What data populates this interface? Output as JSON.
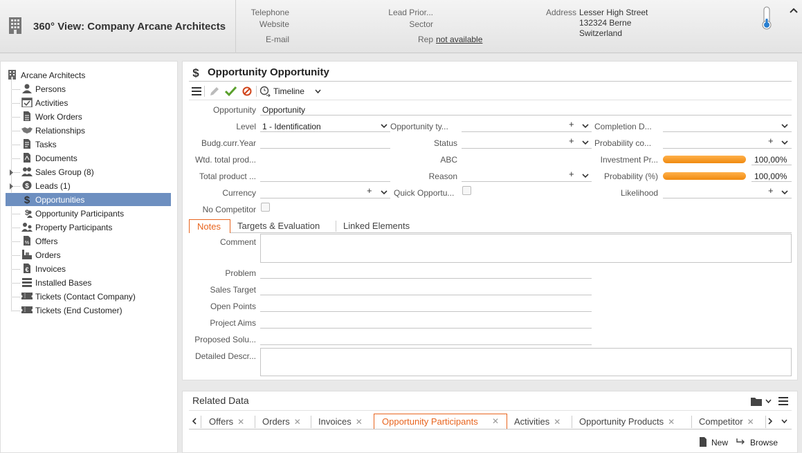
{
  "header": {
    "title": "360° View: Company Arcane Architects",
    "fields": [
      {
        "label": "Telephone",
        "value": ""
      },
      {
        "label": "Website",
        "value": ""
      },
      {
        "label": "E-mail",
        "value": ""
      },
      {
        "label": "Lead Prior...",
        "value": ""
      },
      {
        "label": "Sector",
        "value": ""
      },
      {
        "label": "Rep",
        "value": "not available"
      },
      {
        "label": "Address",
        "value": "Lesser High Street"
      }
    ],
    "address_line2": "132324 Berne",
    "address_line3": "Switzerland"
  },
  "tree": {
    "root": "Arcane Architects",
    "items": [
      {
        "label": "Persons",
        "icon": "person-icon"
      },
      {
        "label": "Activities",
        "icon": "calendar-check-icon"
      },
      {
        "label": "Work Orders",
        "icon": "document-icon"
      },
      {
        "label": "Relationships",
        "icon": "handshake-icon"
      },
      {
        "label": "Tasks",
        "icon": "task-icon"
      },
      {
        "label": "Documents",
        "icon": "document-icon"
      },
      {
        "label": "Sales Group (8)",
        "icon": "group-icon"
      },
      {
        "label": "Leads (1)",
        "icon": "lead-icon"
      },
      {
        "label": "Opportunities",
        "icon": "dollar-icon"
      },
      {
        "label": "Opportunity Participants",
        "icon": "participants-icon"
      },
      {
        "label": "Property Participants",
        "icon": "participants-icon"
      },
      {
        "label": "Offers",
        "icon": "offer-icon"
      },
      {
        "label": "Orders",
        "icon": "order-icon"
      },
      {
        "label": "Invoices",
        "icon": "euro-icon"
      },
      {
        "label": "Installed Bases",
        "icon": "installed-base-icon"
      },
      {
        "label": "Tickets (Contact Company)",
        "icon": "ticket-icon"
      },
      {
        "label": "Tickets (End Customer)",
        "icon": "ticket-icon"
      }
    ]
  },
  "card": {
    "title": "Opportunity Opportunity",
    "toolbar": {
      "timeline": "Timeline"
    },
    "fields": {
      "opportunity": {
        "label": "Opportunity",
        "value": "Opportunity"
      },
      "level": {
        "label": "Level",
        "value": "1 - Identification"
      },
      "opportunity_type": {
        "label": "Opportunity ty..."
      },
      "completion_date": {
        "label": "Completion D..."
      },
      "budg_year": {
        "label": "Budg.curr.Year"
      },
      "status": {
        "label": "Status"
      },
      "probability_co": {
        "label": "Probability co..."
      },
      "wtd_total": {
        "label": "Wtd. total prod..."
      },
      "abc": {
        "label": "ABC"
      },
      "investment_pr": {
        "label": "Investment Pr...",
        "value": "100,00%"
      },
      "total_product": {
        "label": "Total product ..."
      },
      "reason": {
        "label": "Reason"
      },
      "probability_pct": {
        "label": "Probability (%)",
        "value": "100,00%"
      },
      "currency": {
        "label": "Currency"
      },
      "quick_opportunity": {
        "label": "Quick Opportu..."
      },
      "likelihood": {
        "label": "Likelihood"
      },
      "no_competitor": {
        "label": "No Competitor"
      }
    },
    "investment_level": 1.0,
    "probability_level": 1.0,
    "tabs": [
      "Notes",
      "Targets & Evaluation",
      "Linked Elements"
    ],
    "notes": {
      "comment": "Comment",
      "problem": "Problem",
      "sales_target": "Sales Target",
      "open_points": "Open Points",
      "project_aims": "Project Aims",
      "proposed_solution": "Proposed Solu...",
      "detailed_description": "Detailed Descr..."
    }
  },
  "related": {
    "title": "Related Data",
    "tabs": [
      "Offers",
      "Orders",
      "Invoices",
      "Opportunity Participants",
      "Activities",
      "Opportunity Products",
      "Competitor"
    ],
    "active_tab": "Opportunity Participants",
    "new_label": "New",
    "browse_label": "Browse"
  },
  "colors": {
    "accent": "#e8641e",
    "selection": "#6d8fc0",
    "bar": "#f08a10"
  }
}
